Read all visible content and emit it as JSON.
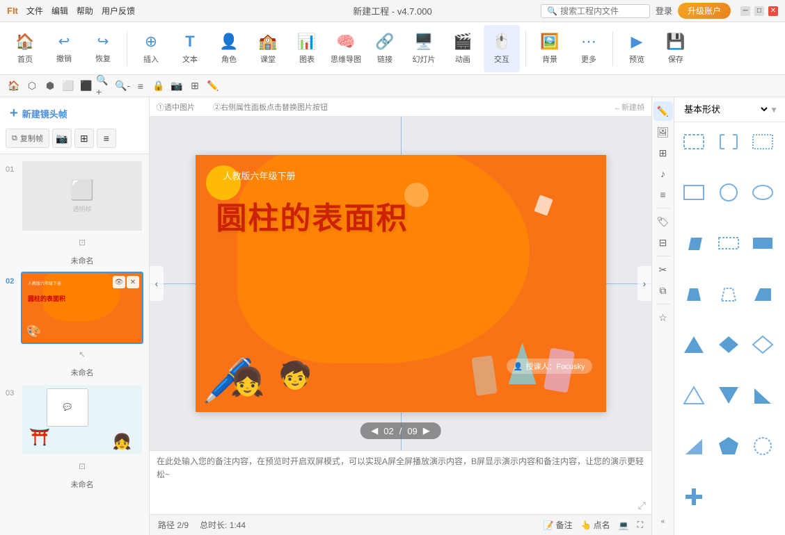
{
  "app": {
    "name": "FIt",
    "title": "新建工程 - v4.7.000",
    "search_placeholder": "搜索工程内文件",
    "login_label": "登录",
    "upgrade_label": "升级账户"
  },
  "menu": {
    "items": [
      "文件",
      "编辑",
      "帮助",
      "用户反馈"
    ]
  },
  "toolbar": {
    "items": [
      {
        "id": "home",
        "label": "首页",
        "icon": "🏠"
      },
      {
        "id": "undo",
        "label": "撤销",
        "icon": "↩"
      },
      {
        "id": "redo",
        "label": "恢复",
        "icon": "↪"
      },
      {
        "id": "insert",
        "label": "插入",
        "icon": "➕"
      },
      {
        "id": "text",
        "label": "文本",
        "icon": "T"
      },
      {
        "id": "role",
        "label": "角色",
        "icon": "👤"
      },
      {
        "id": "class",
        "label": "课堂",
        "icon": "🏫"
      },
      {
        "id": "chart",
        "label": "图表",
        "icon": "📊"
      },
      {
        "id": "mindmap",
        "label": "思维导图",
        "icon": "🧠"
      },
      {
        "id": "link",
        "label": "链接",
        "icon": "🔗"
      },
      {
        "id": "slide",
        "label": "幻灯片",
        "icon": "🖥️"
      },
      {
        "id": "animation",
        "label": "动画",
        "icon": "🎬"
      },
      {
        "id": "interact",
        "label": "交互",
        "icon": "🖱️"
      },
      {
        "id": "background",
        "label": "背景",
        "icon": "🖼️"
      },
      {
        "id": "more",
        "label": "更多",
        "icon": "…"
      },
      {
        "id": "preview",
        "label": "预览",
        "icon": "▶"
      },
      {
        "id": "save",
        "label": "保存",
        "icon": "💾"
      }
    ]
  },
  "canvas_labels": {
    "label1": "①透中图片",
    "label2": "②右侧属性面板点击替换图片按钮",
    "label3": "←新建帧"
  },
  "slide_panel": {
    "new_frame_label": "新建镜头帧",
    "copy_label": "复制帧",
    "slides": [
      {
        "num": "01",
        "label": "未命名"
      },
      {
        "num": "02",
        "label": "未命名"
      },
      {
        "num": "03",
        "label": "未命名"
      }
    ]
  },
  "canvas": {
    "subtitle": "人教版六年级下册",
    "main_title": "圆柱的表面积",
    "author": "授课人：Focusky",
    "page_current": "02",
    "page_total": "09"
  },
  "notes": {
    "placeholder": "在此处输入您的备注内容，在预览时开启双屏模式，可以实现A屏全屏播放演示内容，B屏显示演示内容和备注内容，让您的演示更轻松~"
  },
  "statusbar": {
    "path": "路径 2/9",
    "duration": "总时长: 1:44",
    "notes_btn": "备注",
    "pointer_btn": "点名"
  },
  "shapes_panel": {
    "category": "基本形状",
    "shapes": [
      {
        "id": "rect-dashed",
        "type": "rect-dashed"
      },
      {
        "id": "bracket",
        "type": "bracket"
      },
      {
        "id": "rect-dotted",
        "type": "rect-dotted"
      },
      {
        "id": "rect-solid",
        "type": "rect-solid"
      },
      {
        "id": "circle",
        "type": "circle"
      },
      {
        "id": "ellipse",
        "type": "ellipse"
      },
      {
        "id": "parallelogram",
        "type": "parallelogram"
      },
      {
        "id": "rect-dotted2",
        "type": "rect-dotted2"
      },
      {
        "id": "rect-solid2",
        "type": "rect-solid2"
      },
      {
        "id": "trapezoid",
        "type": "trapezoid"
      },
      {
        "id": "trapezoid-dashed",
        "type": "trapezoid-dashed"
      },
      {
        "id": "trapezoid-solid",
        "type": "trapezoid-solid"
      },
      {
        "id": "triangle-solid",
        "type": "triangle-solid"
      },
      {
        "id": "diamond",
        "type": "diamond"
      },
      {
        "id": "diamond-outline",
        "type": "diamond-outline"
      },
      {
        "id": "triangle-outline",
        "type": "triangle-outline"
      },
      {
        "id": "triangle-solid2",
        "type": "triangle-solid2"
      },
      {
        "id": "right-triangle",
        "type": "right-triangle"
      },
      {
        "id": "right-triangle2",
        "type": "right-triangle2"
      },
      {
        "id": "pentagon",
        "type": "pentagon"
      },
      {
        "id": "circle-dotted",
        "type": "circle-dotted"
      },
      {
        "id": "plus",
        "type": "plus"
      }
    ]
  },
  "right_icons": [
    "pen",
    "image",
    "table",
    "music",
    "layers",
    "badge",
    "grid",
    "scissors",
    "stack",
    "star",
    "chevron-double-left"
  ]
}
